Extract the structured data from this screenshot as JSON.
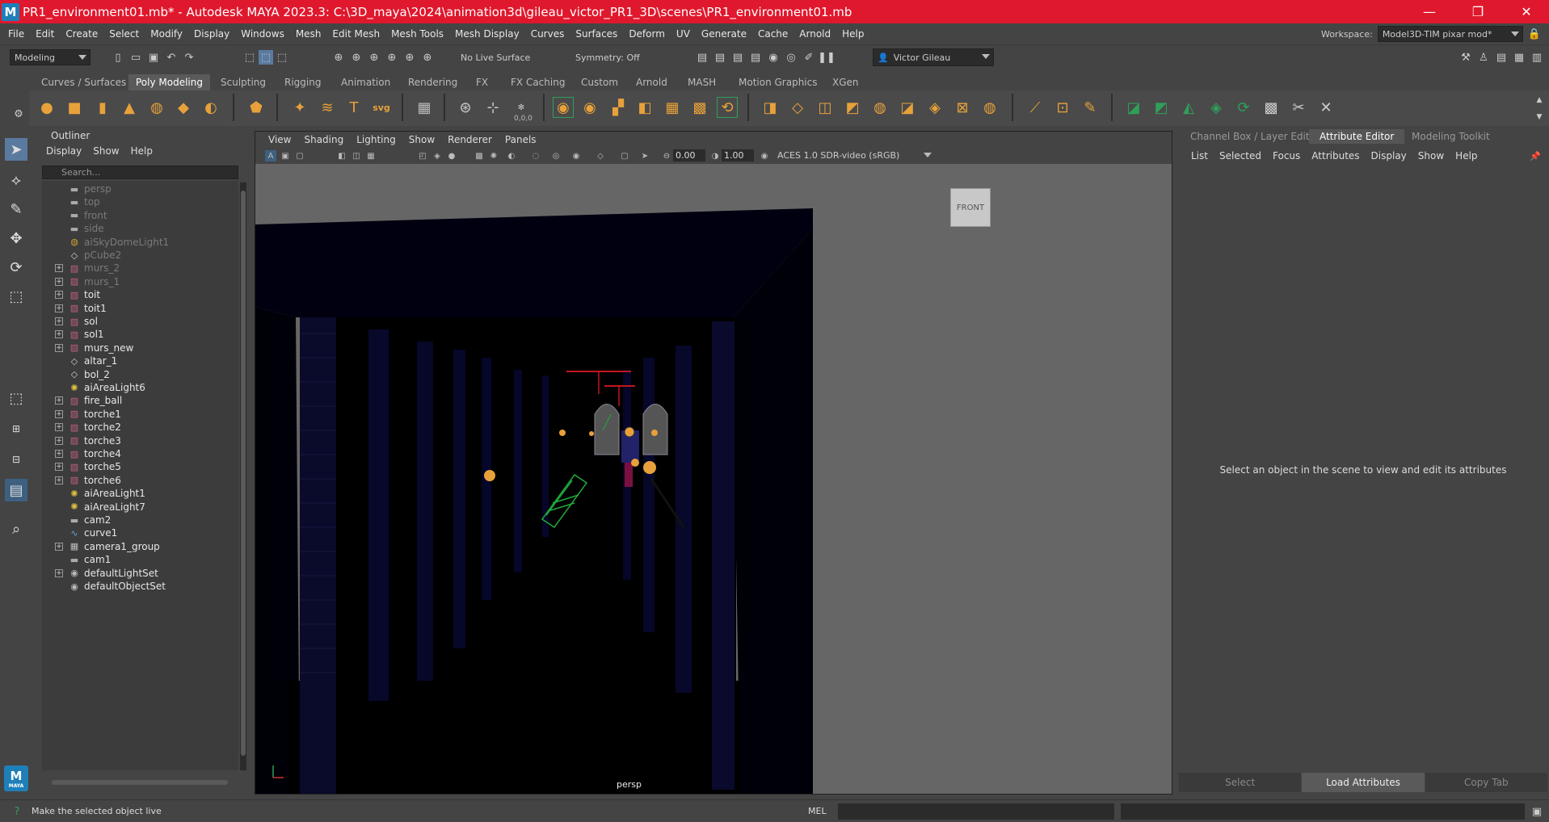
{
  "window": {
    "title": "PR1_environment01.mb* - Autodesk MAYA 2023.3: C:\\3D_maya\\2024\\animation3d\\gileau_victor_PR1_3D\\scenes\\PR1_environment01.mb",
    "logo": "M",
    "minimize": "—",
    "maximize": "❐",
    "close": "✕"
  },
  "menubar": {
    "items": [
      "File",
      "Edit",
      "Create",
      "Select",
      "Modify",
      "Display",
      "Windows",
      "Mesh",
      "Edit Mesh",
      "Mesh Tools",
      "Mesh Display",
      "Curves",
      "Surfaces",
      "Deform",
      "UV",
      "Generate",
      "Cache",
      "Arnold",
      "Help"
    ],
    "workspace_label": "Workspace:",
    "workspace_value": "Model3D-TIM pixar mod*"
  },
  "statusline": {
    "mode": "Modeling",
    "live_surface": "No Live Surface",
    "symmetry": "Symmetry: Off",
    "user": "Victor Gileau"
  },
  "shelf": {
    "tabs": [
      "Curves / Surfaces",
      "Poly Modeling",
      "Sculpting",
      "Rigging",
      "Animation",
      "Rendering",
      "FX",
      "FX Caching",
      "Custom",
      "Arnold",
      "MASH",
      "Motion Graphics",
      "XGen"
    ],
    "active_tab": "Poly Modeling",
    "coord_label": "0,0,0"
  },
  "outliner": {
    "title": "Outliner",
    "menu": [
      "Display",
      "Show",
      "Help"
    ],
    "search_placeholder": "Search...",
    "items": [
      {
        "label": "persp",
        "icon": "camera-icon",
        "expandable": false,
        "dim": true
      },
      {
        "label": "top",
        "icon": "camera-icon",
        "expandable": false,
        "dim": true
      },
      {
        "label": "front",
        "icon": "camera-icon",
        "expandable": false,
        "dim": true
      },
      {
        "label": "side",
        "icon": "camera-icon",
        "expandable": false,
        "dim": true
      },
      {
        "label": "aiSkyDomeLight1",
        "icon": "skydome-icon",
        "expandable": false,
        "dim": true
      },
      {
        "label": "pCube2",
        "icon": "mesh-icon",
        "expandable": false,
        "dim": true
      },
      {
        "label": "murs_2",
        "icon": "group-icon",
        "expandable": true,
        "dim": true
      },
      {
        "label": "murs_1",
        "icon": "group-icon",
        "expandable": true,
        "dim": true
      },
      {
        "label": "toit",
        "icon": "group-icon",
        "expandable": true,
        "dim": false
      },
      {
        "label": "toit1",
        "icon": "group-icon",
        "expandable": true,
        "dim": false
      },
      {
        "label": "sol",
        "icon": "group-icon",
        "expandable": true,
        "dim": false
      },
      {
        "label": "sol1",
        "icon": "group-icon",
        "expandable": true,
        "dim": false
      },
      {
        "label": "murs_new",
        "icon": "group-icon",
        "expandable": true,
        "dim": false
      },
      {
        "label": "altar_1",
        "icon": "mesh-icon",
        "expandable": false,
        "dim": false
      },
      {
        "label": "bol_2",
        "icon": "mesh-icon",
        "expandable": false,
        "dim": false
      },
      {
        "label": "aiAreaLight6",
        "icon": "light-icon",
        "expandable": false,
        "dim": false
      },
      {
        "label": "fire_ball",
        "icon": "group-icon",
        "expandable": true,
        "dim": false
      },
      {
        "label": "torche1",
        "icon": "group-icon",
        "expandable": true,
        "dim": false
      },
      {
        "label": "torche2",
        "icon": "group-icon",
        "expandable": true,
        "dim": false
      },
      {
        "label": "torche3",
        "icon": "group-icon",
        "expandable": true,
        "dim": false
      },
      {
        "label": "torche4",
        "icon": "group-icon",
        "expandable": true,
        "dim": false
      },
      {
        "label": "torche5",
        "icon": "group-icon",
        "expandable": true,
        "dim": false
      },
      {
        "label": "torche6",
        "icon": "group-icon",
        "expandable": true,
        "dim": false
      },
      {
        "label": "aiAreaLight1",
        "icon": "light-icon",
        "expandable": false,
        "dim": false
      },
      {
        "label": "aiAreaLight7",
        "icon": "light-icon",
        "expandable": false,
        "dim": false
      },
      {
        "label": "cam2",
        "icon": "camera-icon",
        "expandable": false,
        "dim": false
      },
      {
        "label": "curve1",
        "icon": "curve-icon",
        "expandable": false,
        "dim": false
      },
      {
        "label": "camera1_group",
        "icon": "camera-group-icon",
        "expandable": true,
        "dim": false
      },
      {
        "label": "cam1",
        "icon": "camera-icon",
        "expandable": false,
        "dim": false
      },
      {
        "label": "defaultLightSet",
        "icon": "set-icon",
        "expandable": true,
        "dim": false
      },
      {
        "label": "defaultObjectSet",
        "icon": "set-icon",
        "expandable": false,
        "dim": false
      }
    ]
  },
  "viewport": {
    "menu": [
      "View",
      "Shading",
      "Lighting",
      "Show",
      "Renderer",
      "Panels"
    ],
    "exposure": "0.00",
    "gamma": "1.00",
    "color_space": "ACES 1.0 SDR-video (sRGB)",
    "camera_label": "persp",
    "viewcube_label": "FRONT"
  },
  "attribute_editor": {
    "tabs": [
      "Channel Box / Layer Editor",
      "Attribute Editor",
      "Modeling Toolkit"
    ],
    "active_tab": "Attribute Editor",
    "menu": [
      "List",
      "Selected",
      "Focus",
      "Attributes",
      "Display",
      "Show",
      "Help"
    ],
    "message": "Select an object in the scene to view and edit its attributes",
    "buttons": [
      "Select",
      "Load Attributes",
      "Copy Tab"
    ]
  },
  "helpline": {
    "text": "Make the selected object live",
    "mel_label": "MEL"
  },
  "colors": {
    "titlebar": "#e0182d",
    "panel_bg": "#444444",
    "viewport_bg": "#666666",
    "maya_blue": "#1f7fb8",
    "shelf_orange": "#e8a13a",
    "shelf_green": "#2fa05a"
  }
}
